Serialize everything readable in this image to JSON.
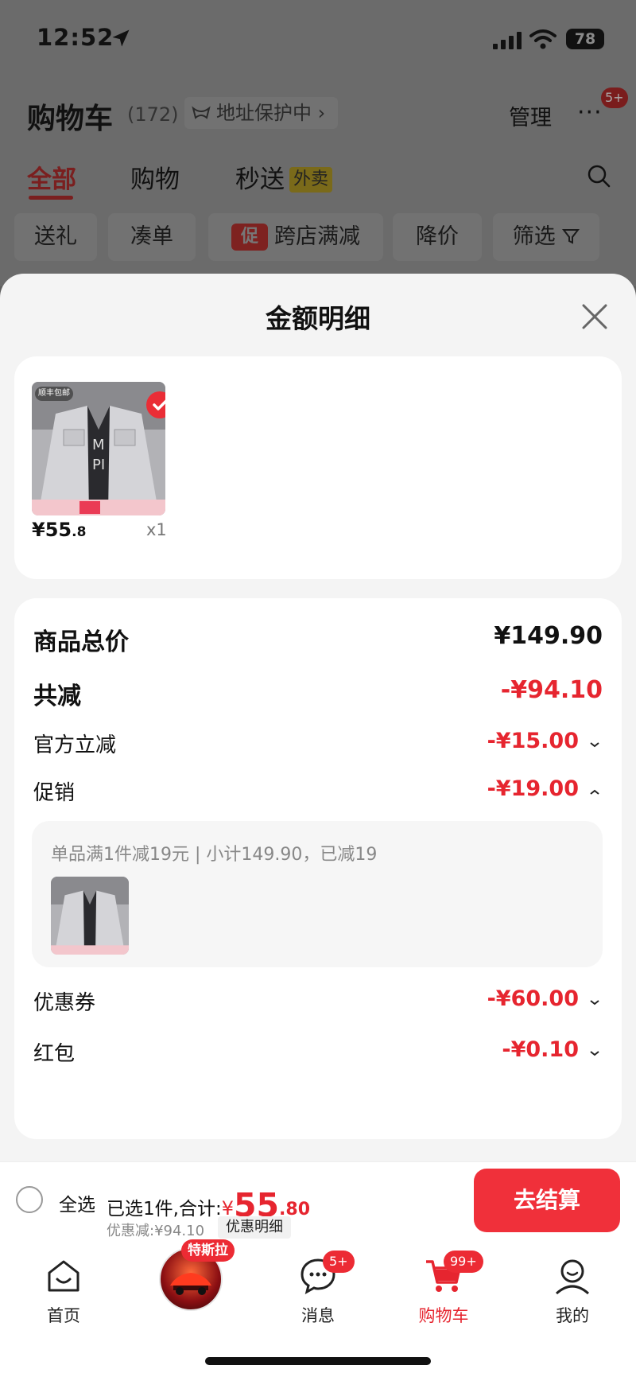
{
  "status_bar": {
    "time": "12:52",
    "battery": "78"
  },
  "header": {
    "title": "购物车",
    "count": "(172)",
    "address_chip": "地址保护中 ›",
    "manage": "管理",
    "more": "···",
    "more_badge": "5+"
  },
  "tabs": [
    {
      "label": "全部",
      "active": true
    },
    {
      "label": "购物"
    },
    {
      "label": "秒送",
      "tag": "外卖"
    }
  ],
  "filters": [
    {
      "label": "送礼"
    },
    {
      "label": "凑单"
    },
    {
      "label": "跨店满减",
      "tag": "促"
    },
    {
      "label": "降价"
    },
    {
      "label": "筛选"
    }
  ],
  "sheet": {
    "title": "金额明细",
    "product": {
      "price_main": "¥55",
      "price_cents": ".8",
      "qty": "x1",
      "img_tag": "顺丰包邮"
    },
    "rows": {
      "total_label": "商品总价",
      "total_value": "¥149.90",
      "reduce_label": "共减",
      "reduce_value": "-¥94.10",
      "official_label": "官方立减",
      "official_value": "-¥15.00",
      "promo_label": "促销",
      "promo_value": "-¥19.00",
      "promo_detail": "单品满1件减19元 | 小计149.90，已减19",
      "coupon_label": "优惠券",
      "coupon_value": "-¥60.00",
      "redpack_label": "红包",
      "redpack_value": "-¥0.10"
    }
  },
  "checkout": {
    "select_all": "全选",
    "selected_prefix": "已选1件,合计:",
    "yen": "¥",
    "amount": "55",
    "decimal": ".80",
    "discount": "优惠减:¥94.10",
    "detail_link": "优惠明细",
    "button": "去结算"
  },
  "nav": {
    "home": "首页",
    "tesla_tag": "特斯拉",
    "messages": "消息",
    "messages_badge": "5+",
    "cart": "购物车",
    "cart_badge": "99+",
    "me": "我的"
  },
  "colors": {
    "accent": "#e6252f",
    "checkout_button": "#f0303a",
    "overlay_bg": "#5e5e5e"
  }
}
